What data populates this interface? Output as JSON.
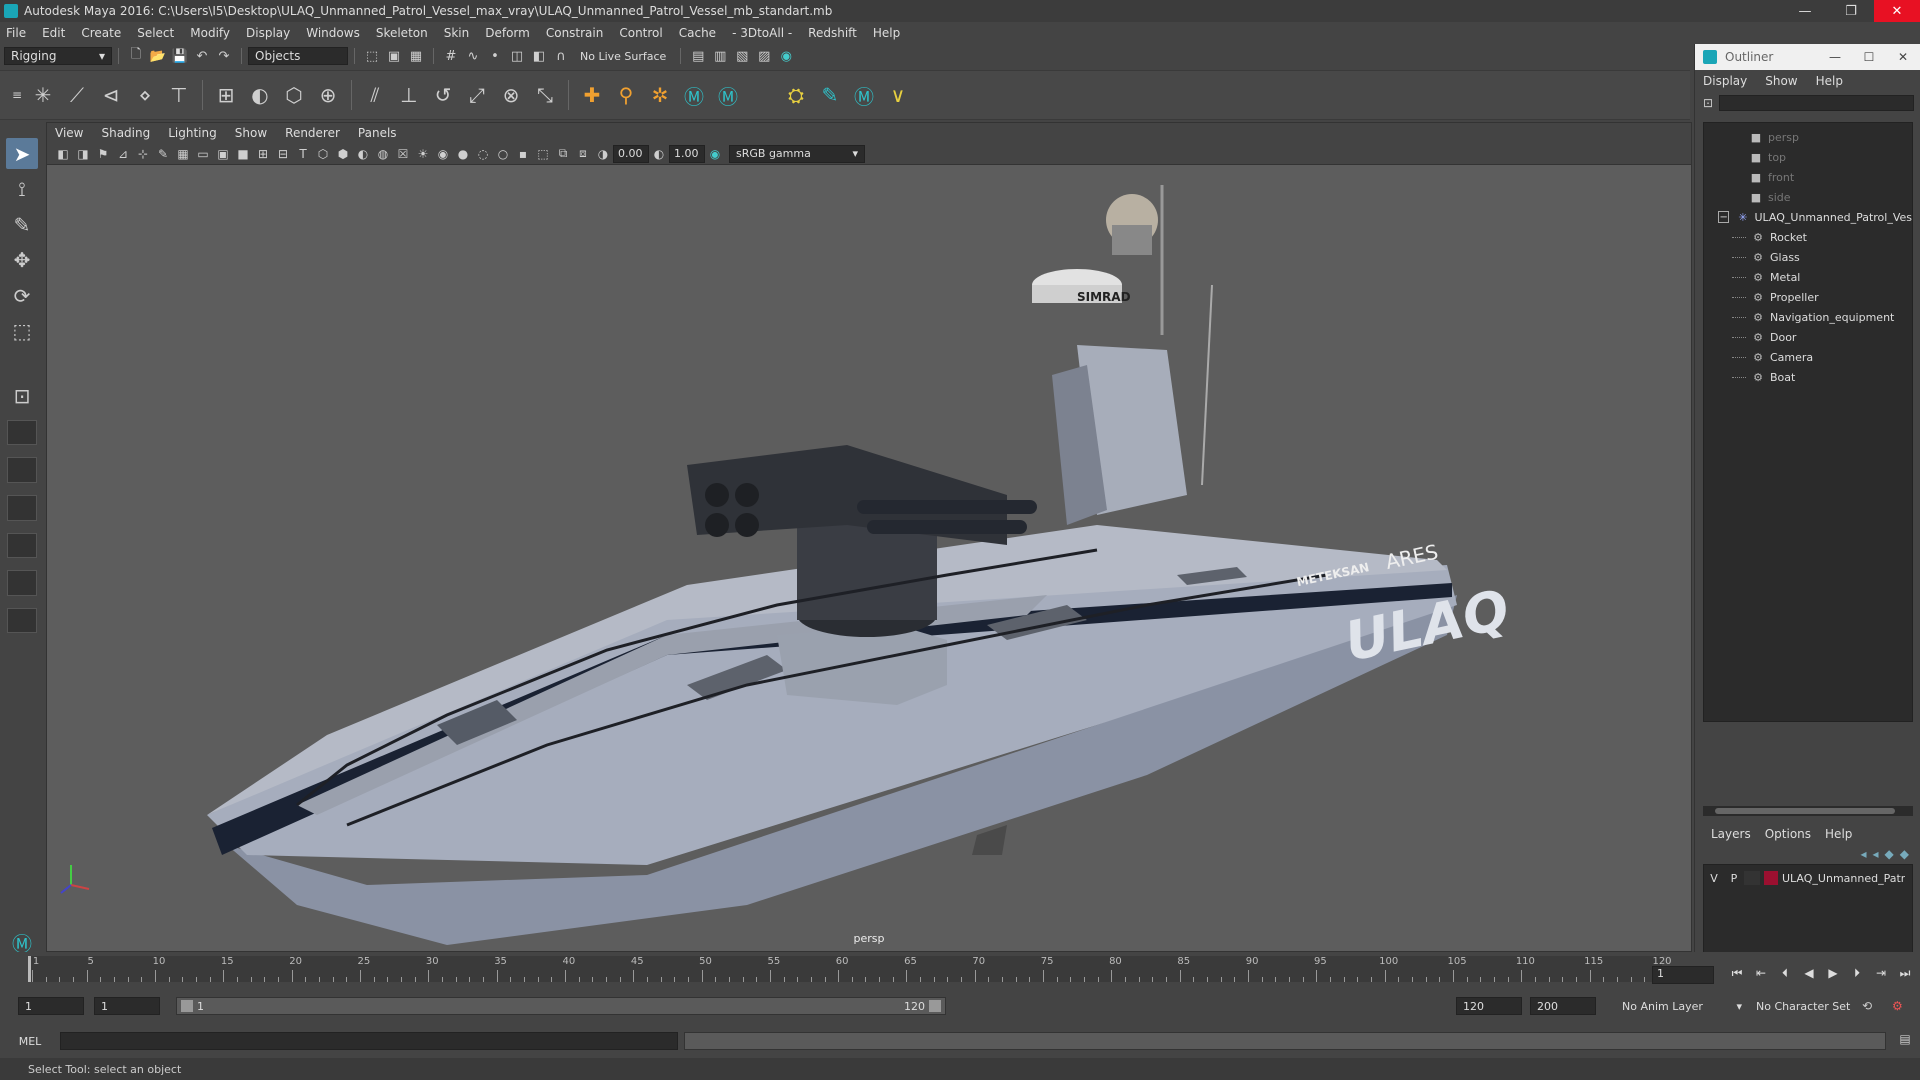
{
  "window": {
    "title": "Autodesk Maya 2016: C:\\Users\\I5\\Desktop\\ULAQ_Unmanned_Patrol_Vessel_max_vray\\ULAQ_Unmanned_Patrol_Vessel_mb_standart.mb",
    "min": "—",
    "max": "❐",
    "close": "✕"
  },
  "menu": [
    "File",
    "Edit",
    "Create",
    "Select",
    "Modify",
    "Display",
    "Windows",
    "Skeleton",
    "Skin",
    "Deform",
    "Constrain",
    "Control",
    "Cache",
    "- 3DtoAll -",
    "Redshift",
    "Help"
  ],
  "statusline": {
    "menuset": "Rigging",
    "selection_mode": "Objects",
    "live_surface": "No Live Surface"
  },
  "viewport": {
    "menu": [
      "View",
      "Shading",
      "Lighting",
      "Show",
      "Renderer",
      "Panels"
    ],
    "exposure": "0.00",
    "gamma_value": "1.00",
    "color_space": "sRGB gamma",
    "camera": "persp",
    "boat_text": "ULAQ",
    "brand_text": "ARES",
    "radar_text": "SIMRAD",
    "maker_text": "METEKSAN"
  },
  "outliner": {
    "title": "Outliner",
    "menu": [
      "Display",
      "Show",
      "Help"
    ],
    "cameras": [
      "persp",
      "top",
      "front",
      "side"
    ],
    "root": "ULAQ_Unmanned_Patrol_Ves",
    "children": [
      "Rocket",
      "Glass",
      "Metal",
      "Propeller",
      "Navigation_equipment",
      "Door",
      "Camera",
      "Boat"
    ]
  },
  "layers": {
    "menu": [
      "Layers",
      "Options",
      "Help"
    ],
    "row": {
      "v": "V",
      "p": "P",
      "name": "ULAQ_Unmanned_Patr"
    }
  },
  "timeline": {
    "labels": [
      "1",
      "5",
      "10",
      "15",
      "20",
      "25",
      "30",
      "35",
      "40",
      "45",
      "50",
      "55",
      "60",
      "65",
      "70",
      "75",
      "80",
      "85",
      "90",
      "95",
      "100",
      "105",
      "110",
      "115",
      "120"
    ],
    "current_frame": "1"
  },
  "range": {
    "start": "1",
    "playback_start": "1",
    "slider_start": "1",
    "slider_end": "120",
    "playback_end": "120",
    "end": "200",
    "anim_layer": "No Anim Layer",
    "character_set": "No Character Set"
  },
  "cmdline": {
    "label": "MEL"
  },
  "helpline": {
    "text": "Select Tool: select an object"
  }
}
